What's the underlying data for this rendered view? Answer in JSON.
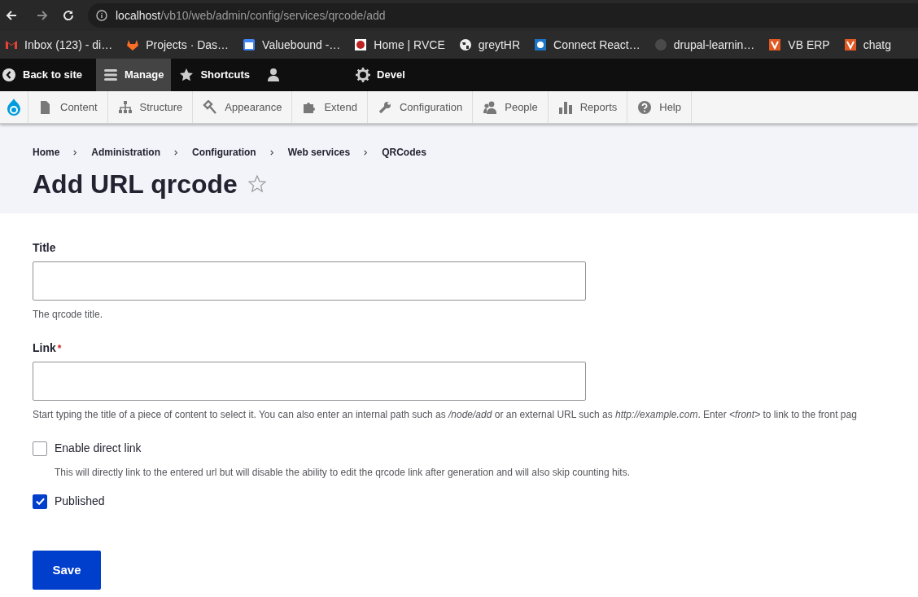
{
  "browser": {
    "url_host": "localhost",
    "url_path": "/vb10/web/admin/config/services/qrcode/add",
    "bookmarks": [
      {
        "label": "Inbox (123) - di…",
        "kind": "mail"
      },
      {
        "label": "Projects · Das…",
        "kind": "fox"
      },
      {
        "label": "Valuebound -…",
        "kind": "calendar"
      },
      {
        "label": "Home | RVCE",
        "kind": "crest"
      },
      {
        "label": "greytHR",
        "kind": "globe"
      },
      {
        "label": "Connect React…",
        "kind": "star"
      },
      {
        "label": "drupal-learnin…",
        "kind": "octocat"
      },
      {
        "label": "VB ERP",
        "kind": "v"
      },
      {
        "label": "chatg",
        "kind": "v"
      }
    ]
  },
  "toolbar": {
    "items": [
      {
        "label": "Back to site",
        "kind": "back",
        "selected": false
      },
      {
        "label": "Manage",
        "kind": "menu",
        "selected": true
      },
      {
        "label": "Shortcuts",
        "kind": "star",
        "selected": false
      },
      {
        "kind": "user",
        "selected": false
      },
      {
        "label": "Devel",
        "kind": "gear",
        "selected": false
      }
    ]
  },
  "tray": {
    "items": [
      {
        "label": "Content",
        "kind": "page"
      },
      {
        "label": "Structure",
        "kind": "tree"
      },
      {
        "label": "Appearance",
        "kind": "brush"
      },
      {
        "label": "Extend",
        "kind": "puzzle"
      },
      {
        "label": "Configuration",
        "kind": "wrench"
      },
      {
        "label": "People",
        "kind": "people"
      },
      {
        "label": "Reports",
        "kind": "bars"
      },
      {
        "label": "Help",
        "kind": "help"
      }
    ]
  },
  "breadcrumb": [
    "Home",
    "Administration",
    "Configuration",
    "Web services",
    "QRCodes"
  ],
  "page_title": "Add URL qrcode",
  "form": {
    "fields": [
      {
        "kind": "text",
        "label": "Title",
        "description": "The qrcode title."
      },
      {
        "kind": "text",
        "label": "Link",
        "required_mark": "*",
        "description": "Start typing the title of a piece of content to select it. You can also enter an internal path such as */node/add* or an external URL such as *http://example.com*. Enter *<front>* to link to the front pag"
      },
      {
        "kind": "checkbox",
        "label": "Enable direct link",
        "checked": false,
        "description": "This will directly link to the entered url but will disable the ability to edit the qrcode link after generation and will also skip counting hits."
      },
      {
        "kind": "checkbox",
        "label": "Published",
        "checked": true
      }
    ],
    "submit": "Save"
  }
}
